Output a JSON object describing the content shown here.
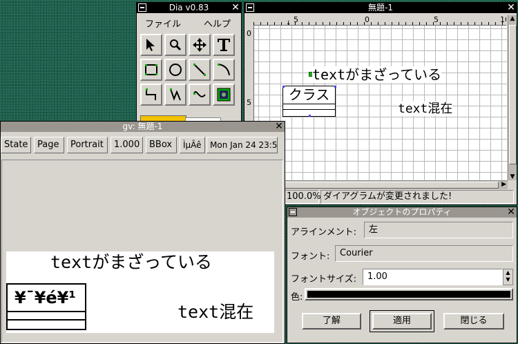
{
  "toolbox": {
    "title": "Dia v0.83",
    "menu": [
      "ファイル",
      "ヘルプ"
    ],
    "tools": [
      "pointer-tool",
      "magnify-tool",
      "scroll-tool",
      "text-tool",
      "box-tool",
      "ellipse-tool",
      "line-tool",
      "arc-tool",
      "zigzag-tool",
      "polyline-tool",
      "bezier-tool",
      "image-tool"
    ]
  },
  "diagram": {
    "title": "無題-1",
    "ruler_h": [
      "5",
      "0",
      "5",
      "10"
    ],
    "ruler_v": [
      "0",
      "5"
    ],
    "text1": "textがまざっている",
    "class_name": "クラス",
    "text2": "text混在",
    "zoom": "100.0%",
    "status": "ダイアグラムが変更されました!"
  },
  "gv": {
    "title": "gv: 無題-1",
    "buttons": [
      "State",
      "Page",
      "Portrait",
      "1.000",
      "BBox",
      "ÌµÂê",
      "Mon Jan 24 23:5"
    ],
    "text1": "textがまざっている",
    "class_name": "¥¯¥é¥¹",
    "text2": "text混在"
  },
  "props": {
    "title": "オブジェクトのプロパティ",
    "align_label": "アラインメント:",
    "align_value": "左",
    "font_label": "フォント:",
    "font_value": "Courier",
    "size_label": "フォントサイズ:",
    "size_value": "1.00",
    "color_label": "色:",
    "color_value": "#000000",
    "ok": "了解",
    "apply": "適用",
    "close": "閉じる"
  }
}
